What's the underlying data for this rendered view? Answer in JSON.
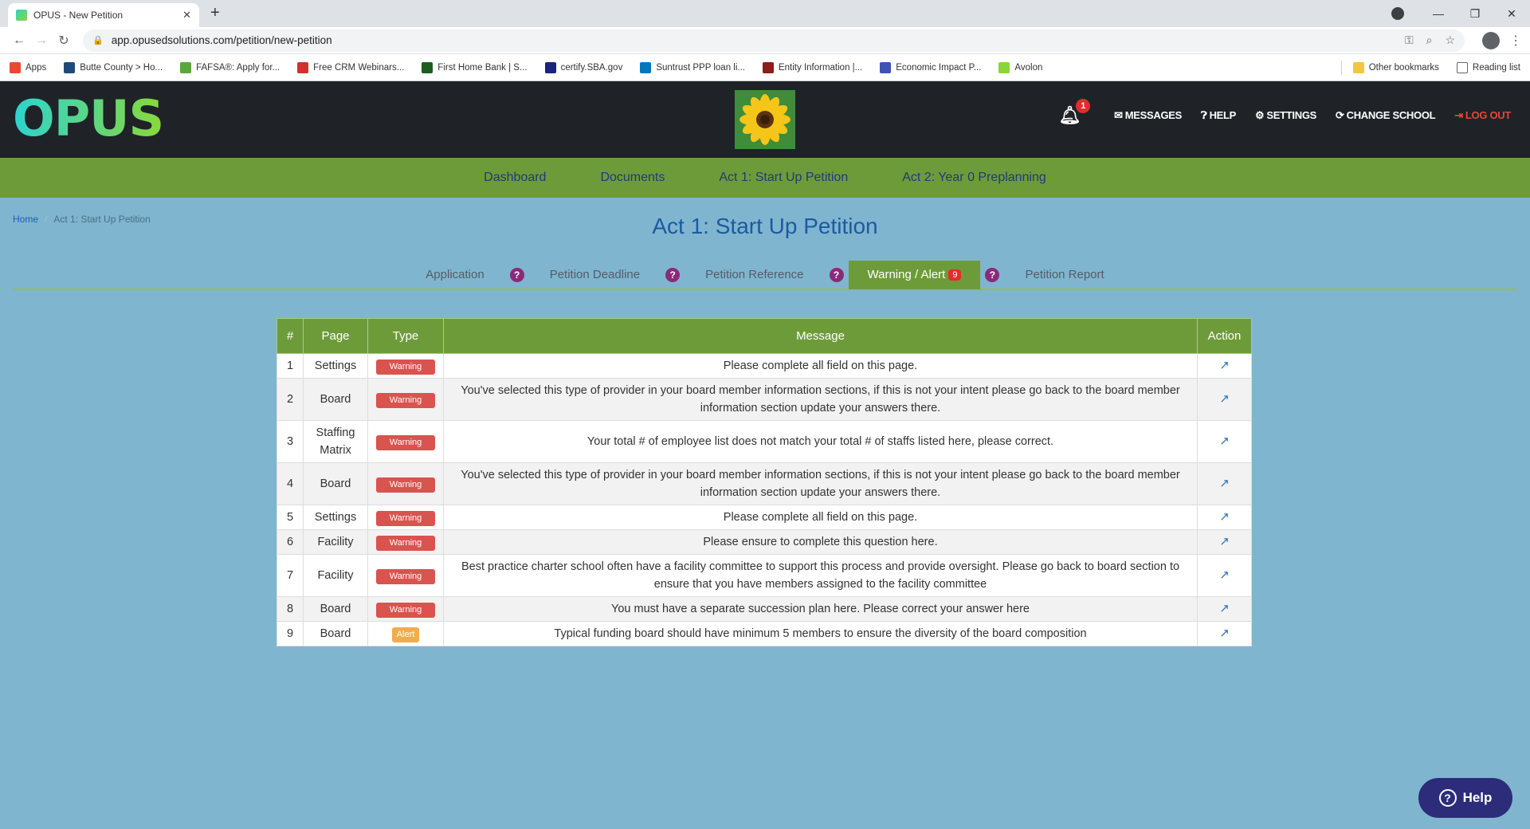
{
  "browser": {
    "tab_title": "OPUS - New Petition",
    "tab_close": "✕",
    "new_tab": "+",
    "url": "app.opusedsolutions.com/petition/new-petition",
    "bookmarks": [
      {
        "label": "Apps",
        "color": "#e84a2f"
      },
      {
        "label": "Butte County > Ho...",
        "color": "#1e4a7a"
      },
      {
        "label": "FAFSA®: Apply for...",
        "color": "#5aa83c"
      },
      {
        "label": "Free CRM Webinars...",
        "color": "#d32f2f"
      },
      {
        "label": "First Home Bank | S...",
        "color": "#1b5e20"
      },
      {
        "label": "certify.SBA.gov",
        "color": "#1a237e"
      },
      {
        "label": "Suntrust PPP loan li...",
        "color": "#0277bd"
      },
      {
        "label": "Entity Information |...",
        "color": "#8d1c1c"
      },
      {
        "label": "Economic Impact P...",
        "color": "#3f51b5"
      },
      {
        "label": "Avolon",
        "color": "#8bd43a"
      }
    ],
    "other_bookmarks": "Other bookmarks",
    "reading_list": "Reading list"
  },
  "header": {
    "logo": "OPUS",
    "notification_count": "1",
    "nav": {
      "messages": "MESSAGES",
      "help": "HELP",
      "settings": "SETTINGS",
      "change_school": "CHANGE SCHOOL",
      "logout": "LOG OUT"
    }
  },
  "main_nav": [
    "Dashboard",
    "Documents",
    "Act 1: Start Up Petition",
    "Act 2: Year 0 Preplanning"
  ],
  "breadcrumb": {
    "home": "Home",
    "current": "Act 1: Start Up Petition"
  },
  "page_title": "Act 1: Start Up Petition",
  "subtabs": {
    "application": "Application",
    "deadline": "Petition Deadline",
    "reference": "Petition Reference",
    "warning": "Warning / Alert",
    "warning_count": "9",
    "report": "Petition Report"
  },
  "table": {
    "headers": {
      "num": "#",
      "page": "Page",
      "type": "Type",
      "message": "Message",
      "action": "Action"
    },
    "rows": [
      {
        "num": "1",
        "page": "Settings",
        "type": "Warning",
        "message": "Please complete all field on this page."
      },
      {
        "num": "2",
        "page": "Board",
        "type": "Warning",
        "message": "You've selected this type of provider in your board member information sections, if this is not your intent please go back to the board member information section update your answers there."
      },
      {
        "num": "3",
        "page": "Staffing Matrix",
        "type": "Warning",
        "message": "Your total # of employee list does not match your total # of staffs listed here, please correct."
      },
      {
        "num": "4",
        "page": "Board",
        "type": "Warning",
        "message": "You've selected this type of provider in your board member information sections, if this is not your intent please go back to the board member information section update your answers there."
      },
      {
        "num": "5",
        "page": "Settings",
        "type": "Warning",
        "message": "Please complete all field on this page."
      },
      {
        "num": "6",
        "page": "Facility",
        "type": "Warning",
        "message": "Please ensure to complete this question here."
      },
      {
        "num": "7",
        "page": "Facility",
        "type": "Warning",
        "message": "Best practice charter school often have a facility committee to support this process and provide oversight. Please go back to board section to ensure that you have members assigned to the facility committee"
      },
      {
        "num": "8",
        "page": "Board",
        "type": "Warning",
        "message": "You must have a separate succession plan here. Please correct your answer here"
      },
      {
        "num": "9",
        "page": "Board",
        "type": "Alert",
        "message": "Typical funding board should have minimum 5 members to ensure the diversity of the board composition"
      }
    ]
  },
  "help_button": "Help"
}
